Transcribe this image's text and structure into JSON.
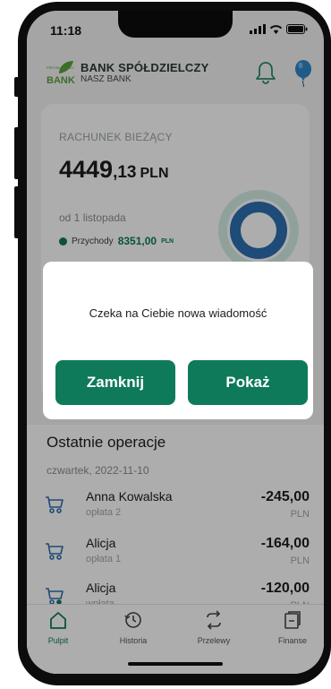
{
  "status_bar": {
    "time": "11:18"
  },
  "header": {
    "logo_small_text": "PRZYKŁADOWY",
    "logo_text": "BANK",
    "bank_name": "BANK SPÓŁDZIELCZY",
    "bank_subtitle": "NASZ BANK",
    "bell_icon": "bell-icon",
    "balloon_icon": "balloon-icon"
  },
  "account": {
    "title": "RACHUNEK BIEŻĄCY",
    "balance_int": "4449",
    "balance_dec": ",13",
    "currency": "PLN",
    "period": "od 1 listopada",
    "income_label": "Przychody",
    "income_value": "8351,00",
    "income_currency": "PLN"
  },
  "dialog": {
    "message": "Czeka na Ciebie nowa wiadomość",
    "close_label": "Zamknij",
    "show_label": "Pokaż"
  },
  "operations": {
    "title": "Ostatnie operacje",
    "date": "czwartek, 2022-11-10",
    "items": [
      {
        "name": "Anna Kowalska",
        "sub": "opłata 2",
        "amount": "-245,00",
        "currency": "PLN"
      },
      {
        "name": "Alicja",
        "sub": "opłata 1",
        "amount": "-164,00",
        "currency": "PLN"
      },
      {
        "name": "Alicja",
        "sub": "wpłata",
        "amount": "-120,00",
        "currency": "PLN"
      }
    ]
  },
  "tabs": [
    {
      "label": "Pulpit",
      "icon": "home-icon"
    },
    {
      "label": "Historia",
      "icon": "history-icon"
    },
    {
      "label": "Przelewy",
      "icon": "transfer-icon"
    },
    {
      "label": "Finanse",
      "icon": "finance-icon"
    }
  ],
  "colors": {
    "accent": "#0f7a5a",
    "overlay": "rgba(0,0,0,0.32)"
  }
}
